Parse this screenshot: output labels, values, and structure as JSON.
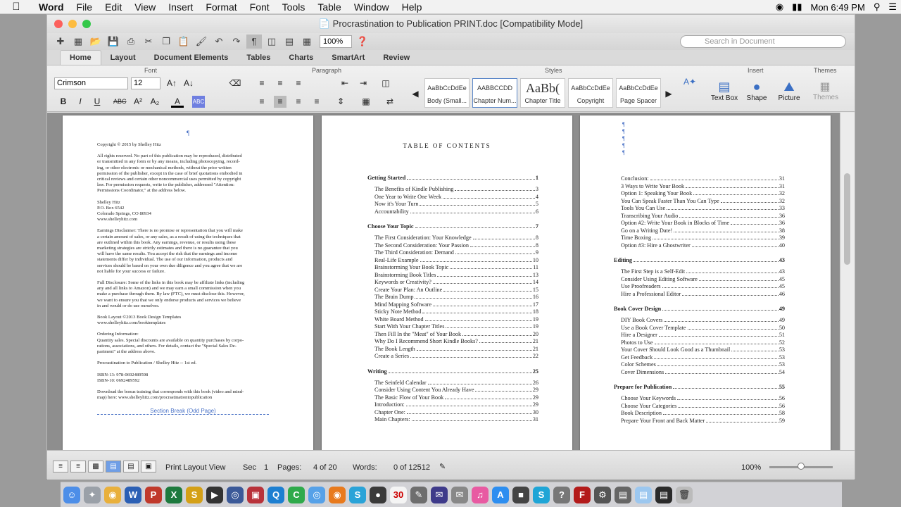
{
  "menubar": {
    "app": "Word",
    "items": [
      "File",
      "Edit",
      "View",
      "Insert",
      "Format",
      "Font",
      "Tools",
      "Table",
      "Window",
      "Help"
    ],
    "clock": "Mon 6:49 PM"
  },
  "window": {
    "title": "Procrastination to Publication PRINT.doc [Compatibility Mode]"
  },
  "toolbar": {
    "zoom": "100%",
    "search_placeholder": "Search in Document"
  },
  "tabs": [
    "Home",
    "Layout",
    "Document Elements",
    "Tables",
    "Charts",
    "SmartArt",
    "Review"
  ],
  "ribbon": {
    "font_group": "Font",
    "paragraph_group": "Paragraph",
    "styles_group": "Styles",
    "insert_group": "Insert",
    "themes_group": "Themes",
    "font_name": "Crimson",
    "font_size": "12",
    "styles": [
      {
        "preview": "AaBbCcDdEe",
        "label": "Body (Small..."
      },
      {
        "preview": "AABBCCDD",
        "label": "Chapter Num..."
      },
      {
        "preview": "AaBb(",
        "label": "Chapter Title"
      },
      {
        "preview": "AaBbCcDdEe",
        "label": "Copyright"
      },
      {
        "preview": "AaBbCcDdEe",
        "label": "Page Spacer"
      }
    ],
    "insert_items": [
      "Text Box",
      "Shape",
      "Picture"
    ],
    "themes_label": "Themes"
  },
  "page1": {
    "lines": [
      "Copyright © 2015 by Shelley Hitz",
      "",
      "All rights reserved. No part of this publication may be reproduced, distributed",
      "or transmitted in any form or by any means, including photocopying, record-",
      "ing, or other electronic or mechanical methods, without the prior written",
      "permission of the publisher, except in the case of brief quotations embodied in",
      "critical reviews and certain other noncommercial uses permitted by copyright",
      "law. For permission requests, write to the publisher, addressed \"Attention:",
      "Permissions Coordinator,\" at the address below.",
      "",
      "Shelley Hitz",
      "P.O. Box 6542",
      "Colorado Springs, CO 80934",
      "www.shelleyhitz.com",
      "",
      "Earnings Disclaimer: There is no promise or representation that you will make",
      "a certain amount of sales, or any sales, as a result of using the techniques that",
      "are outlined within this book. Any earnings, revenue, or results using these",
      "marketing strategies are strictly estimates and there is no guarantee that you",
      "will have the same results. You accept the risk that the earnings and income",
      "statements differ by individual. The use of our information, products and",
      "services should be based on your own due diligence and you agree that we are",
      "not liable for your success or failure.",
      "",
      "Full Disclosure: Some of the links in this book may be affiliate links (including",
      "any and all links to Amazon) and we may earn a small commission when you",
      "make a purchase through them. By law (FTC), we must disclose this. However,",
      "we want to ensure you that we only endorse products and services we believe",
      "in and would or do use ourselves.",
      "",
      "Book Layout ©2013 Book Design Templates",
      "www.shelleyhitz.com/booktemplates",
      "",
      "Ordering Information:",
      "Quantity sales. Special discounts are available on quantity purchases by corpo-",
      "rations, associations, and others. For details, contact the \"Special Sales De-",
      "partment\" at the address above.",
      "",
      "Procrastination to Publication / Shelley Hitz -- 1st ed.",
      "",
      "ISBN-13: 978-0692489598",
      "ISBN-10: 0692489592",
      "",
      "Download the bonus training that corresponds with this book (video and mind-",
      "map) here: www.shelleyhitz.com/procrastinationtopublication",
      ""
    ],
    "section_break": "Section Break (Odd Page)"
  },
  "toc": {
    "title": "TABLE OF CONTENTS",
    "entries": [
      {
        "t": "Getting Started",
        "n": "1",
        "h": true
      },
      {
        "t": "The Benefits of Kindle Publishing",
        "n": "3"
      },
      {
        "t": "One Year to Write One Week",
        "n": "4"
      },
      {
        "t": "Now it's Your Turn",
        "n": "5"
      },
      {
        "t": "Accountability",
        "n": "6"
      },
      {
        "t": "Choose Your Topic",
        "n": "7",
        "h": true
      },
      {
        "t": "The First Consideration: Your Knowledge",
        "n": "8"
      },
      {
        "t": "The Second Consideration: Your Passion",
        "n": "8"
      },
      {
        "t": "The Third Consideration: Demand",
        "n": "9"
      },
      {
        "t": "Real-Life Example",
        "n": "10"
      },
      {
        "t": "Brainstorming Your Book Topic",
        "n": "11"
      },
      {
        "t": "Brainstorming Book Titles",
        "n": "13"
      },
      {
        "t": "Keywords or Creativity?",
        "n": "14"
      },
      {
        "t": "Create Your Plan:  An Outline",
        "n": "15"
      },
      {
        "t": "The Brain Dump",
        "n": "16"
      },
      {
        "t": "Mind Mapping Software",
        "n": "17"
      },
      {
        "t": "Sticky Note Method",
        "n": "18"
      },
      {
        "t": "White Board Method",
        "n": "19"
      },
      {
        "t": "Start With Your Chapter Titles",
        "n": "19"
      },
      {
        "t": "Then Fill In the \"Meat\" of Your Book",
        "n": "20"
      },
      {
        "t": "Why Do I Recommend Short Kindle Books?",
        "n": "21"
      },
      {
        "t": "The Book Length",
        "n": "21"
      },
      {
        "t": "Create a Series",
        "n": "22"
      },
      {
        "t": "Writing",
        "n": "25",
        "h": true
      },
      {
        "t": "The Seinfeld Calendar",
        "n": "26"
      },
      {
        "t": "Consider Using Content You Already Have",
        "n": "29"
      },
      {
        "t": "The Basic Flow of Your Book",
        "n": "29"
      },
      {
        "t": "Introduction:",
        "n": "29"
      },
      {
        "t": "Chapter One:",
        "n": "30"
      },
      {
        "t": "Main Chapters:",
        "n": "31"
      }
    ]
  },
  "toc2": {
    "entries": [
      {
        "t": "Conclusion:",
        "n": "31"
      },
      {
        "t": "3 Ways to Write Your Book",
        "n": "31"
      },
      {
        "t": "Option 1:  Speaking Your Book",
        "n": "32"
      },
      {
        "t": "You Can Speak Faster Than You Can Type",
        "n": "32"
      },
      {
        "t": "Tools You Can Use",
        "n": "33"
      },
      {
        "t": "Transcribing Your Audio",
        "n": "36"
      },
      {
        "t": "Option #2: Write Your Book in Blocks of Time",
        "n": "36"
      },
      {
        "t": "Go on a Writing Date!",
        "n": "38"
      },
      {
        "t": "Time Boxing",
        "n": "39"
      },
      {
        "t": "Option #3:  Hire a Ghostwriter",
        "n": "40"
      },
      {
        "t": "Editing",
        "n": "43",
        "h": true
      },
      {
        "t": "The First Step is a Self-Edit",
        "n": "43"
      },
      {
        "t": "Consider Using Editing Software",
        "n": "45"
      },
      {
        "t": "Use Proofreaders",
        "n": "45"
      },
      {
        "t": "Hire a Professional Editor",
        "n": "46"
      },
      {
        "t": "Book Cover Design",
        "n": "49",
        "h": true
      },
      {
        "t": "DIY Book Covers",
        "n": "49"
      },
      {
        "t": "Use a Book Cover Template",
        "n": "50"
      },
      {
        "t": "Hire a Designer",
        "n": "51"
      },
      {
        "t": "Photos to Use",
        "n": "52"
      },
      {
        "t": "Your Cover Should Look Good as a Thumbnail",
        "n": "53"
      },
      {
        "t": "Get Feedback",
        "n": "53"
      },
      {
        "t": "Color Schemes",
        "n": "53"
      },
      {
        "t": "Cover Dimensions",
        "n": "54"
      },
      {
        "t": "Prepare for Publication",
        "n": "55",
        "h": true
      },
      {
        "t": "Choose Your Keywords",
        "n": "56"
      },
      {
        "t": "Choose Your Categories",
        "n": "56"
      },
      {
        "t": "Book Description",
        "n": "58"
      },
      {
        "t": "Prepare Your Front and Back Matter",
        "n": "59"
      }
    ]
  },
  "status": {
    "view": "Print Layout View",
    "sec_label": "Sec",
    "sec": "1",
    "pages_label": "Pages:",
    "pages": "4 of 20",
    "words_label": "Words:",
    "words": "0 of 12512",
    "zoom": "100%"
  }
}
